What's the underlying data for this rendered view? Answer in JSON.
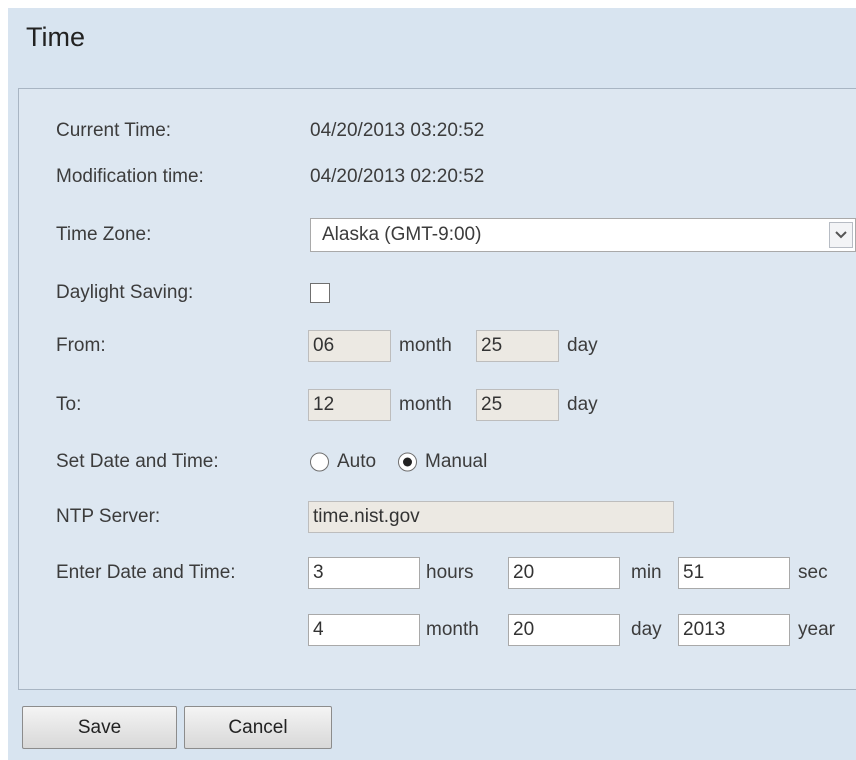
{
  "title": "Time",
  "current_time": {
    "label": "Current Time:",
    "value": "04/20/2013 03:20:52"
  },
  "modification_time": {
    "label": "Modification time:",
    "value": "04/20/2013 02:20:52"
  },
  "time_zone": {
    "label": "Time Zone:",
    "value": "Alaska (GMT-9:00)"
  },
  "daylight_saving": {
    "label": "Daylight Saving:",
    "checked": false
  },
  "from": {
    "label": "From:",
    "month": "06",
    "month_unit": "month",
    "day": "25",
    "day_unit": "day"
  },
  "to": {
    "label": "To:",
    "month": "12",
    "month_unit": "month",
    "day": "25",
    "day_unit": "day"
  },
  "set_date_time": {
    "label": "Set Date and Time:",
    "auto_label": "Auto",
    "manual_label": "Manual",
    "selected": "Manual"
  },
  "ntp_server": {
    "label": "NTP Server:",
    "value": "time.nist.gov"
  },
  "enter_date_time": {
    "label": "Enter Date and Time:",
    "hours": "3",
    "hours_unit": "hours",
    "min": "20",
    "min_unit": "min",
    "sec": "51",
    "sec_unit": "sec",
    "month": "4",
    "month_unit": "month",
    "day": "20",
    "day_unit": "day",
    "year": "2013",
    "year_unit": "year"
  },
  "buttons": {
    "save": "Save",
    "cancel": "Cancel"
  },
  "colors": {
    "background": "#d8e4f0",
    "panel": "#dde7f1",
    "disabled_field": "#ece9e3"
  },
  "icons": {
    "dropdown": "chevron-down-icon"
  }
}
